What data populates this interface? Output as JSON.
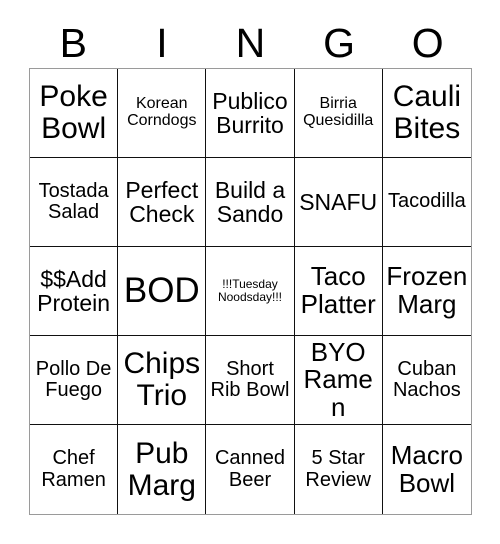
{
  "card": {
    "title_letters": [
      "B",
      "I",
      "N",
      "G",
      "O"
    ],
    "columns": 5,
    "rows": 5,
    "colors": {
      "background": "#ffffff",
      "text": "#000000",
      "grid_line": "#111111",
      "outer_border": "#9a9a9a"
    },
    "cells": [
      {
        "row": 1,
        "col": 1,
        "text": "Poke Bowl",
        "size": "t-xl"
      },
      {
        "row": 1,
        "col": 2,
        "text": "Korean Corndogs",
        "size": "t-xs"
      },
      {
        "row": 1,
        "col": 3,
        "text": "Publico Burrito",
        "size": "t-md"
      },
      {
        "row": 1,
        "col": 4,
        "text": "Birria Quesidilla",
        "size": "t-xs"
      },
      {
        "row": 1,
        "col": 5,
        "text": "Cauli Bites",
        "size": "t-xl"
      },
      {
        "row": 2,
        "col": 1,
        "text": "Tostada Salad",
        "size": "t-sm"
      },
      {
        "row": 2,
        "col": 2,
        "text": "Perfect Check",
        "size": "t-md"
      },
      {
        "row": 2,
        "col": 3,
        "text": "Build a Sando",
        "size": "t-md"
      },
      {
        "row": 2,
        "col": 4,
        "text": "SNAFU",
        "size": "t-md"
      },
      {
        "row": 2,
        "col": 5,
        "text": "Tacodilla",
        "size": "t-sm"
      },
      {
        "row": 3,
        "col": 1,
        "text": "$$Add Protein",
        "size": "t-md"
      },
      {
        "row": 3,
        "col": 2,
        "text": "BOD",
        "size": "t-xxl"
      },
      {
        "row": 3,
        "col": 3,
        "text": "!!!Tuesday Noodsday!!!",
        "size": "t-xxs"
      },
      {
        "row": 3,
        "col": 4,
        "text": "Taco Platter",
        "size": "t-lg"
      },
      {
        "row": 3,
        "col": 5,
        "text": "Frozen Marg",
        "size": "t-lg"
      },
      {
        "row": 4,
        "col": 1,
        "text": "Pollo De Fuego",
        "size": "t-sm"
      },
      {
        "row": 4,
        "col": 2,
        "text": "Chips Trio",
        "size": "t-xl"
      },
      {
        "row": 4,
        "col": 3,
        "text": "Short Rib Bowl",
        "size": "t-sm"
      },
      {
        "row": 4,
        "col": 4,
        "text": "BYO Ramen",
        "size": "t-lg"
      },
      {
        "row": 4,
        "col": 5,
        "text": "Cuban Nachos",
        "size": "t-sm"
      },
      {
        "row": 5,
        "col": 1,
        "text": "Chef Ramen",
        "size": "t-sm"
      },
      {
        "row": 5,
        "col": 2,
        "text": "Pub Marg",
        "size": "t-xl"
      },
      {
        "row": 5,
        "col": 3,
        "text": "Canned Beer",
        "size": "t-sm"
      },
      {
        "row": 5,
        "col": 4,
        "text": "5 Star Review",
        "size": "t-sm"
      },
      {
        "row": 5,
        "col": 5,
        "text": "Macro Bowl",
        "size": "t-lg"
      }
    ]
  }
}
